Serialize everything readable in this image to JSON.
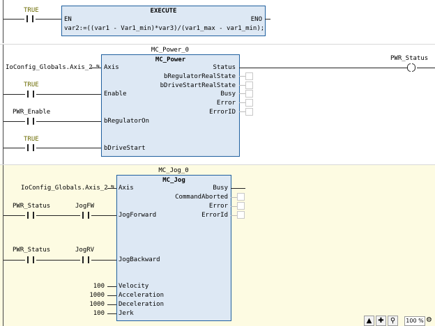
{
  "rung1": {
    "contact_label": "TRUE",
    "block_title": "EXECUTE",
    "en_label": "EN",
    "eno_label": "ENO",
    "expression": "var2:=((var1 - Var1_min)*var3)/(var1_max - var1_min);"
  },
  "rung2": {
    "instance": "MC_Power_0",
    "type": "MC_Power",
    "axis_var": "IoConfig_Globals.Axis_2",
    "inputs": [
      "Axis",
      "Enable",
      "bRegulatorOn",
      "bDriveStart"
    ],
    "outputs": [
      "Status",
      "bRegulatorRealState",
      "bDriveStartRealState",
      "Busy",
      "Error",
      "ErrorID"
    ],
    "enable_contact": "TRUE",
    "regulator_contact": "PWR_Enable",
    "drivestart_contact": "TRUE",
    "coil_label": "PWR_Status"
  },
  "rung3": {
    "instance": "MC_Jog_0",
    "type": "MC_Jog",
    "axis_var": "IoConfig_Globals.Axis_2",
    "inputs": [
      "Axis",
      "JogForward",
      "JogBackward",
      "Velocity",
      "Acceleration",
      "Deceleration",
      "Jerk"
    ],
    "outputs": [
      "Busy",
      "CommandAborted",
      "Error",
      "ErrorId"
    ],
    "fw_contact1": "PWR_Status",
    "fw_contact2": "JogFW",
    "bw_contact1": "PWR_Status",
    "bw_contact2": "JogRV",
    "velocity": "100",
    "acceleration": "1000",
    "deceleration": "1000",
    "jerk": "100"
  },
  "toolbar": {
    "pointer_icon": "cursor-arrow-icon",
    "move_icon": "move-cross-icon",
    "zoom_icon": "magnifier-icon",
    "zoom_level": "100 %",
    "zoom_settings_icon": "zoom-settings-icon"
  },
  "colors": {
    "block_fill": "#dde8f4",
    "block_border": "#1f5f9e",
    "selected_rung_bg": "#fdfbe2",
    "literal_text": "#6b6b00"
  }
}
